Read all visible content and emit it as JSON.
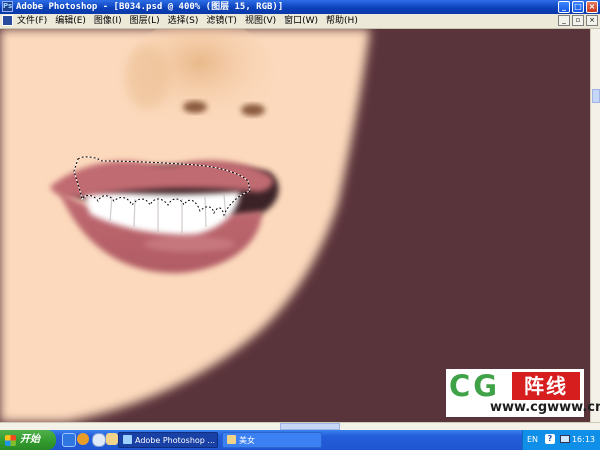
{
  "window": {
    "title": "Adobe Photoshop - [B034.psd @ 400% (图层 15, RGB)]",
    "controls": {
      "minimize": "_",
      "maximize": "□",
      "close": "×"
    }
  },
  "menubar": {
    "items": [
      "文件(F)",
      "编辑(E)",
      "图像(I)",
      "图层(L)",
      "选择(S)",
      "滤镜(T)",
      "视图(V)",
      "窗口(W)",
      "帮助(H)"
    ],
    "doc_controls": {
      "minimize": "_",
      "restore": "▫",
      "close": "×"
    }
  },
  "watermark": {
    "logo_text": "CG",
    "red_text": "阵线",
    "url": "www.cgwww.cn"
  },
  "taskbar": {
    "start_label": "开始",
    "tasks": [
      {
        "label": "Adobe Photoshop ..."
      },
      {
        "label": "美女"
      }
    ],
    "tray": {
      "language": "EN",
      "clock": "16:13"
    }
  },
  "colors": {
    "skin": "#FCD9BC",
    "background": "#5A343B",
    "lips": "#C16C73",
    "teeth": "#FFFFFF",
    "titlebar": "#0A3FB8",
    "taskbar": "#245EDB",
    "start_button": "#329A2D"
  }
}
